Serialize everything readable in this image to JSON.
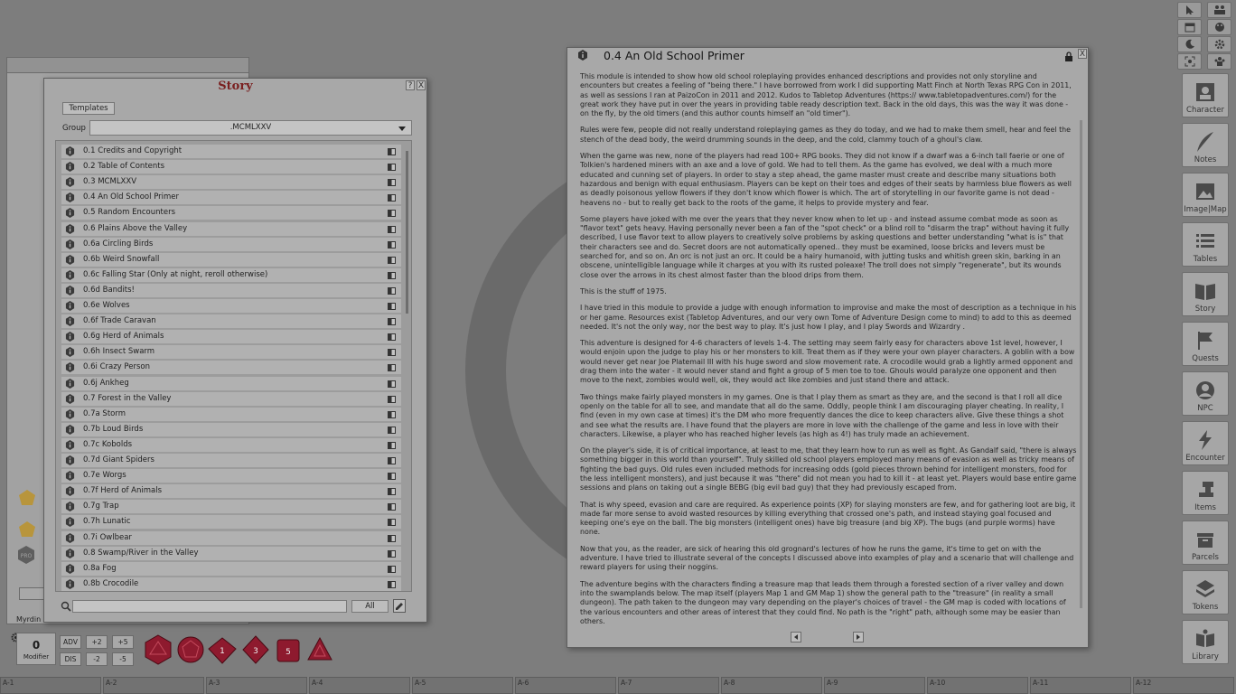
{
  "story_window": {
    "title": "Story",
    "help_btn": "?",
    "close_btn": "X",
    "templates_label": "Templates",
    "group_label": "Group",
    "group_value": ".MCMLXXV",
    "entries": [
      "0.1 Credits and Copyright",
      "0.2 Table of Contents",
      "0.3 MCMLXXV",
      "0.4 An Old School Primer",
      "0.5 Random Encounters",
      "0.6 Plains Above the Valley",
      "0.6a Circling Birds",
      "0.6b Weird Snowfall",
      "0.6c Falling Star (Only at night, reroll otherwise)",
      "0.6d Bandits!",
      "0.6e Wolves",
      "0.6f Trade Caravan",
      "0.6g Herd of Animals",
      "0.6h Insect Swarm",
      "0.6i Crazy Person",
      "0.6j Ankheg",
      "0.7 Forest in the Valley",
      "0.7a Storm",
      "0.7b Loud Birds",
      "0.7c Kobolds",
      "0.7d Giant Spiders",
      "0.7e Worgs",
      "0.7f Herd of Animals",
      "0.7g Trap",
      "0.7h Lunatic",
      "0.7i Owlbear",
      "0.8 Swamp/River in the Valley",
      "0.8a Fog",
      "0.8b Crocodile"
    ],
    "filter_all": "All"
  },
  "document_window": {
    "title": "0.4 An Old School Primer",
    "close_btn": "X",
    "paragraphs": [
      "This module is intended to show how old school roleplaying provides enhanced descriptions and provides not only storyline and encounters but creates a feeling of \"being there.\" I have borrowed from work I did supporting Matt Finch at North Texas RPG Con in 2011, as well as sessions I ran at PaizoCon in 2011 and 2012. Kudos to Tabletop Adventures (https:// www.tabletopadventures.com/) for the great work they have put in over the years in providing table ready description text. Back in the old days, this was the way it was done - on the fly, by the old timers (and this author counts himself an \"old timer\").",
      "Rules were few, people did not really understand roleplaying games as they do today, and we had to make them smell, hear and feel the stench of the dead body, the weird drumming sounds in the deep, and the cold, clammy touch of a ghoul's claw.",
      "When the game was new, none of the players had read 100+ RPG books. They did not know if a dwarf was a 6-inch tall faerie or one of Tolkien's hardened miners with an axe and a love of gold. We had to tell them. As the game has evolved, we deal with a much more educated and cunning set of players. In order to stay a step ahead, the game master must create and describe many situations both hazardous and benign with equal enthusiasm. Players can be kept on their toes and edges of their seats by harmless blue flowers as well as deadly poisonous yellow flowers if they don't know which flower is which. The art of storytelling in our favorite game is not dead - heavens no - but to really get back to the roots of the game, it helps to provide mystery and fear.",
      "Some players have joked with me over the years that they never know when to let up - and instead assume combat mode as soon as \"flavor text\" gets heavy. Having personally never been a fan of the \"spot check\" or a blind roll to \"disarm the trap\" without having it fully described, I use flavor text to allow players to creatively solve problems by asking questions and better understanding \"what is is\" that their characters see and do. Secret doors are not automatically opened.. they must be examined, loose bricks and levers must be searched for, and so on. An orc is not just an orc. It could be a hairy humanoid, with jutting tusks and whitish green skin, barking in an obscene, unintelligible language while it charges at you with its rusted poleaxe! The troll does not simply \"regenerate\", but its wounds close over the arrows in its chest almost faster than the blood drips from them.",
      "This is the stuff of 1975.",
      "I have tried in this module to provide a judge with enough information to improvise and make the most of description as a technique in his or her game. Resources exist (Tabletop Adventures, and our very own Tome of Adventure Design come to mind) to add to this as deemed needed. It's not the only way, nor the best way to play. It's just how I play, and I play Swords and Wizardry .",
      "This adventure is designed for 4-6 characters of levels 1-4. The setting may seem fairly easy for characters above 1st level, however, I would enjoin upon the judge to play his or her monsters to kill. Treat them as if they were your own player characters. A goblin with a bow would never get near Joe Platemail III with his huge sword and slow movement rate. A crocodile would grab a lightly armed opponent and drag them into the water - it would never stand and fight a group of 5 men toe to toe. Ghouls would paralyze one opponent and then move to the next, zombies would well, ok, they would act like zombies and just stand there and attack.",
      "Two things make fairly played monsters in my games. One is that I play them as smart as they are, and the second is that I roll all dice openly on the table for all to see, and mandate that all do the same. Oddly, people think I am discouraging player cheating. In reality, I find (even in my own case at times) it's the DM who more frequently dances the dice to keep characters alive. Give these things a shot and see what the results are. I have found that the players are more in love with the challenge of the game and less in love with their characters. Likewise, a player who has reached higher levels (as high as 4!) has truly made an achievement.",
      "On the player's side, it is of critical importance, at least to me, that they learn how to run as well as fight. As Gandalf said, \"there is always something bigger in this world than yourself\". Truly skilled old school players employed many means of evasion as well as tricky means of fighting the bad guys. Old rules even included methods for increasing odds (gold pieces thrown behind for intelligent monsters, food for the less intelligent monsters), and just because it was \"there\" did not mean you had to kill it - at least yet. Players would base entire game sessions and plans on taking out a single BEBG (big evil bad guy) that they had previously escaped from.",
      "That is why speed, evasion and care are required. As experience points (XP) for slaying monsters are few, and for gathering loot are big, it made far more sense to avoid wasted resources by killing everything that crossed one's path, and instead staying goal focused and keeping one's eye on the ball. The big monsters (intelligent ones) have big treasure (and big XP). The bugs (and purple worms) have none.",
      "Now that you, as the reader, are sick of hearing this old grognard's lectures of how he runs the game, it's time to get on with the adventure. I have tried to illustrate several of the concepts I discussed above into examples of play and a scenario that will challenge and reward players for using their noggins.",
      "The adventure begins with the characters finding a treasure map that leads them through a forested section of a river valley and down into the swamplands below. The map itself (players Map 1 and GM Map 1) show the general path to the \"treasure\" (in reality a small dungeon). The path taken to the dungeon may vary depending on the player's choices of travel - the GM map is coded with locations of the various encounters and other areas of interest that they could find. No path is the \"right\" path, although some may be easier than others."
    ]
  },
  "sidebar": [
    {
      "label": "Character",
      "icon": "character-icon"
    },
    {
      "label": "Notes",
      "icon": "quill-icon"
    },
    {
      "label": "Image|Map",
      "icon": "image-icon"
    },
    {
      "label": "Tables",
      "icon": "list-icon"
    },
    {
      "label": "Story",
      "icon": "book-icon"
    },
    {
      "label": "Quests",
      "icon": "flag-icon"
    },
    {
      "label": "NPC",
      "icon": "npc-icon"
    },
    {
      "label": "Encounter",
      "icon": "lightning-icon"
    },
    {
      "label": "Items",
      "icon": "anvil-icon"
    },
    {
      "label": "Parcels",
      "icon": "box-icon"
    },
    {
      "label": "Tokens",
      "icon": "layers-icon"
    },
    {
      "label": "Library",
      "icon": "library-icon"
    }
  ],
  "back_window": {
    "footer": "Myrdin"
  },
  "modifier": {
    "value": "0",
    "label": "Modifier"
  },
  "mod_buttons": [
    "ADV",
    "+2",
    "+5",
    "DIS",
    "-2",
    "-5"
  ],
  "dice": [
    "d20",
    "d12",
    "d10",
    "d8",
    "d6",
    "d4"
  ],
  "hotkeys": [
    "A-1",
    "A-2",
    "A-3",
    "A-4",
    "A-5",
    "A-6",
    "A-7",
    "A-8",
    "A-9",
    "A-10",
    "A-11",
    "A-12"
  ],
  "colors": {
    "title_red": "#7a2020",
    "die_red": "#8e1a2e",
    "bg": "#7d7d7d"
  }
}
